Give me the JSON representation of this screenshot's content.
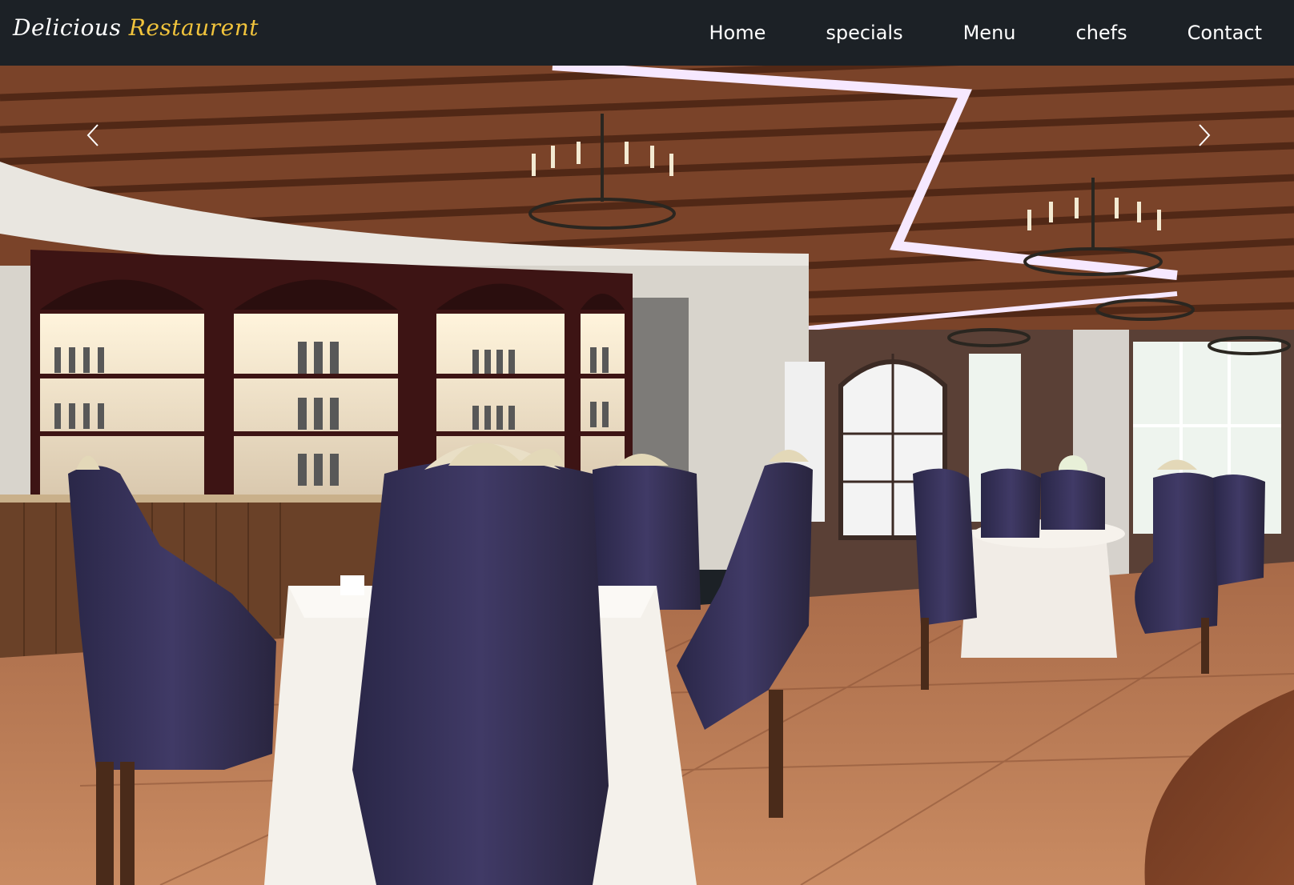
{
  "brand": {
    "first": "Delicious",
    "second": "Restaurent"
  },
  "nav": {
    "items": [
      {
        "label": "Home"
      },
      {
        "label": "specials"
      },
      {
        "label": "Menu"
      },
      {
        "label": "chefs"
      },
      {
        "label": "Contact"
      }
    ]
  },
  "colors": {
    "navbar_bg": "#1c2126",
    "brand_accent": "#f0c33c",
    "nav_text": "#ffffff"
  },
  "hero": {
    "icons": [
      "prev-arrow-icon",
      "next-arrow-icon"
    ]
  }
}
